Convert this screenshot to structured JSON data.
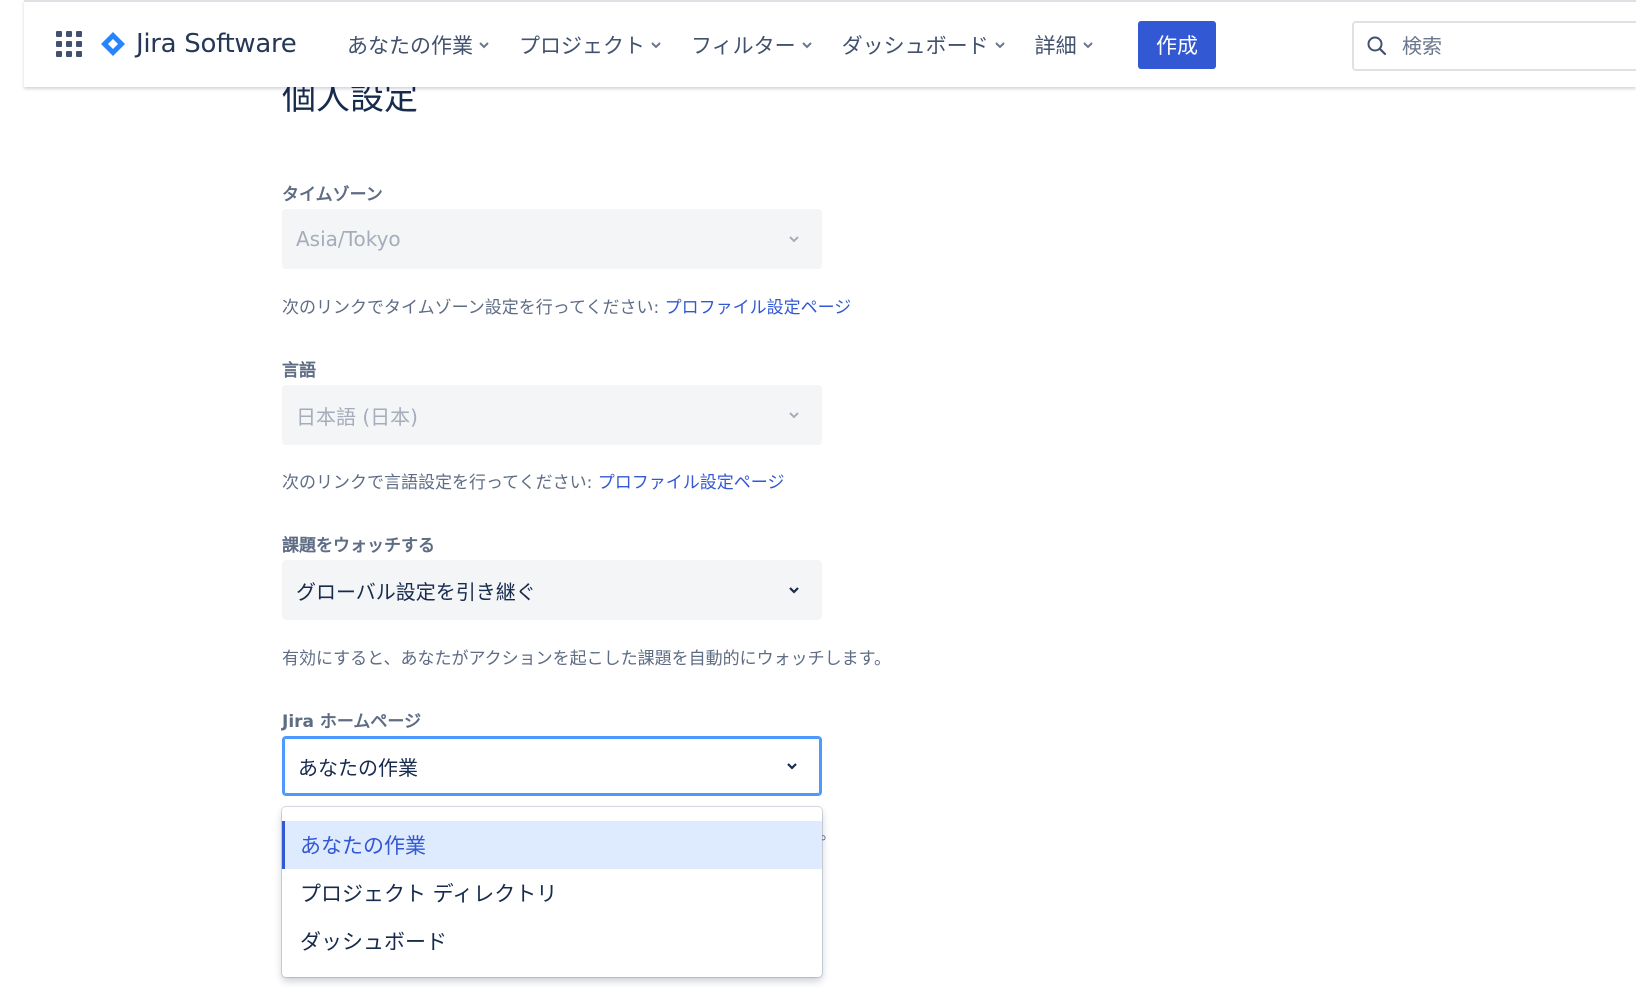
{
  "nav": {
    "app_name": "Jira Software",
    "items": [
      {
        "label": "あなたの作業"
      },
      {
        "label": "プロジェクト"
      },
      {
        "label": "フィルター"
      },
      {
        "label": "ダッシュボード"
      },
      {
        "label": "詳細"
      }
    ],
    "create_label": "作成",
    "search_placeholder": "検索"
  },
  "page": {
    "title": "個人設定"
  },
  "timezone": {
    "label": "タイムゾーン",
    "value": "Asia/Tokyo",
    "help_text": "次のリンクでタイムゾーン設定を行ってください: ",
    "help_link": "プロファイル設定ページ"
  },
  "language": {
    "label": "言語",
    "value": "日本語 (日本)",
    "help_text": "次のリンクで言語設定を行ってください: ",
    "help_link": "プロファイル設定ページ"
  },
  "watch": {
    "label": "課題をウォッチする",
    "value": "グローバル設定を引き継ぐ",
    "help_text": "有効にすると、あなたがアクションを起こした課題を自動的にウォッチします。"
  },
  "homepage": {
    "label": "Jira ホームページ",
    "value": "あなたの作業",
    "options": [
      {
        "label": "あなたの作業",
        "selected": true
      },
      {
        "label": "プロジェクト ディレクトリ",
        "selected": false
      },
      {
        "label": "ダッシュボード",
        "selected": false
      }
    ],
    "trailing_fragment": "。"
  },
  "colors": {
    "brand": "#3358d4",
    "focus": "#4c9aff",
    "selected_bg": "#deebff"
  }
}
